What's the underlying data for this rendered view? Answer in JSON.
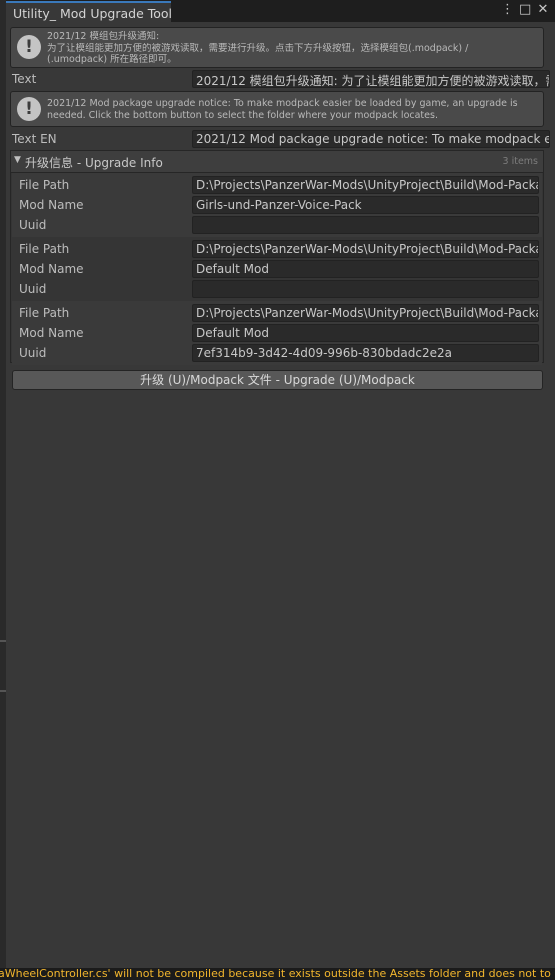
{
  "window": {
    "tab_title": "Utility_ Mod Upgrade Tool",
    "controls": {
      "menu": "⋮",
      "maximize": "□",
      "close": "✕"
    }
  },
  "notice_cn": {
    "icon": "info-icon",
    "lines": [
      "2021/12 模组包升级通知:",
      "为了让模组能更加方便的被游戏读取，需要进行升级。点击下方升级按钮，选择模组包(.modpack) /",
      "(.umodpack) 所在路径即可。"
    ]
  },
  "text_field": {
    "label": "Text",
    "value": "2021/12 模组包升级通知: 为了让模组能更加方便的被游戏读取，需"
  },
  "notice_en": {
    "icon": "info-icon",
    "lines": [
      "2021/12 Mod package upgrade notice: To make modpack easier be loaded by game, an upgrade is",
      "needed. Click the bottom button to select the folder where your modpack locates."
    ]
  },
  "text_en_field": {
    "label": "Text EN",
    "value": "2021/12 Mod package upgrade notice: To make modpack eas"
  },
  "upgrade_info": {
    "title": "升级信息 - Upgrade Info",
    "count": "3 items",
    "labels": {
      "file_path": "File Path",
      "mod_name": "Mod Name",
      "uuid": "Uuid"
    },
    "items": [
      {
        "file_path": "D:\\Projects\\PanzerWar-Mods\\UnityProject\\Build\\Mod-Packa",
        "mod_name": "Girls-und-Panzer-Voice-Pack",
        "uuid": ""
      },
      {
        "file_path": "D:\\Projects\\PanzerWar-Mods\\UnityProject\\Build\\Mod-Packa",
        "mod_name": "Default Mod",
        "uuid": ""
      },
      {
        "file_path": "D:\\Projects\\PanzerWar-Mods\\UnityProject\\Build\\Mod-Packa",
        "mod_name": "Default Mod",
        "uuid": "7ef314b9-3d42-4d09-996b-830bdadc2e2a"
      }
    ]
  },
  "upgrade_button": {
    "label": "升级 (U)/Modpack 文件 - Upgrade (U)/Modpack"
  },
  "console": {
    "message": "aWheelController.cs' will not be compiled because it exists outside the Assets folder and does not to"
  }
}
